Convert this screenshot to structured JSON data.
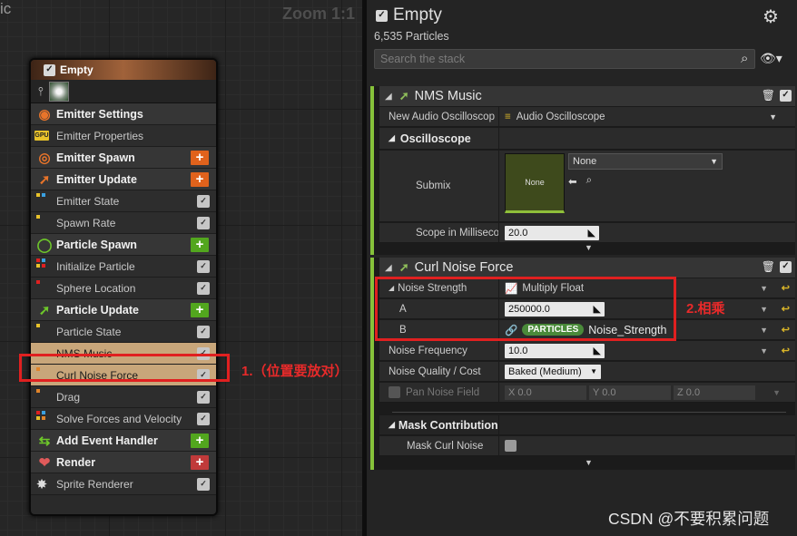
{
  "graph": {
    "corner_text": "ic",
    "zoom": "Zoom 1:1"
  },
  "node": {
    "title": "Empty",
    "rows": [
      {
        "label": "Emitter Settings",
        "kind": "section",
        "icon": "emitter-settings-icon",
        "color": "#e8742a",
        "end": "none"
      },
      {
        "label": "Emitter Properties",
        "kind": "item",
        "icon": "gpu-icon",
        "icon_text": "GPU",
        "end": "none"
      },
      {
        "label": "Emitter Spawn",
        "kind": "section",
        "icon": "emitter-spawn-icon",
        "color": "#e8742a",
        "end": "plus",
        "plus_color": "#e0621c"
      },
      {
        "label": "Emitter Update",
        "kind": "section",
        "icon": "emitter-update-icon",
        "color": "#e8742a",
        "end": "plus",
        "plus_color": "#e0621c"
      },
      {
        "label": "Emitter State",
        "kind": "item",
        "dots": [
          "#e8c22a",
          "#3aa0e0"
        ],
        "end": "check"
      },
      {
        "label": "Spawn Rate",
        "kind": "item",
        "dots": [
          "#e8c22a"
        ],
        "end": "check"
      },
      {
        "label": "Particle Spawn",
        "kind": "section",
        "icon": "particle-spawn-icon",
        "color": "#6ec82a",
        "end": "plus",
        "plus_color": "#52a61e"
      },
      {
        "label": "Initialize Particle",
        "kind": "item",
        "dots": [
          "#e02020",
          "#3aa0e0",
          "#e8c22a",
          "#e02020"
        ],
        "end": "check"
      },
      {
        "label": "Sphere Location",
        "kind": "item",
        "dots": [
          "#e02020"
        ],
        "end": "check"
      },
      {
        "label": "Particle Update",
        "kind": "section",
        "icon": "particle-update-icon",
        "color": "#6ec82a",
        "end": "plus",
        "plus_color": "#52a61e"
      },
      {
        "label": "Particle State",
        "kind": "item",
        "dots": [
          "#e8c22a"
        ],
        "end": "check"
      },
      {
        "label": "NMS Music",
        "kind": "item",
        "highlight": true,
        "dots": [],
        "end": "check"
      },
      {
        "label": "Curl Noise Force",
        "kind": "item",
        "highlight": true,
        "dots": [
          "#e0842a"
        ],
        "end": "check"
      },
      {
        "label": "Drag",
        "kind": "item",
        "dots": [
          "#e0842a"
        ],
        "end": "check"
      },
      {
        "label": "Solve Forces and Velocity",
        "kind": "item",
        "dots": [
          "#e02020",
          "#3aa0e0",
          "#e8c22a",
          "#e0842a"
        ],
        "end": "check"
      },
      {
        "label": "Add Event Handler",
        "kind": "section",
        "icon": "add-event-icon",
        "color": "#6ec82a",
        "end": "plus",
        "plus_color": "#52a61e"
      },
      {
        "label": "Render",
        "kind": "section",
        "icon": "render-icon",
        "color": "#e05a5a",
        "end": "plus",
        "plus_color": "#c03a3a"
      },
      {
        "label": "Sprite Renderer",
        "kind": "item",
        "icon": "sprite-icon",
        "end": "check"
      }
    ]
  },
  "panel": {
    "title": "Empty",
    "particle_count": "6,535 Particles",
    "search_placeholder": "Search the stack",
    "module1": {
      "title": "NMS Music",
      "audio_param_label": "New Audio Oscilloscop",
      "audio_param_value": "Audio Oscilloscope",
      "group_label": "Oscilloscope",
      "submix_label": "Submix",
      "submix_thumb": "None",
      "submix_select": "None",
      "scope_label": "Scope in Milliseco",
      "scope_value": "20.0"
    },
    "module2": {
      "title": "Curl Noise Force",
      "noise_strength_label": "Noise Strength",
      "noise_strength_value": "Multiply Float",
      "a_label": "A",
      "a_value": "250000.0",
      "b_label": "B",
      "b_badge": "PARTICLES",
      "b_value": "Noise_Strength",
      "freq_label": "Noise Frequency",
      "freq_value": "10.0",
      "quality_label": "Noise Quality / Cost",
      "quality_value": "Baked (Medium)",
      "pan_label": "Pan Noise Field",
      "pan_x": "X 0.0",
      "pan_y": "Y 0.0",
      "pan_z": "Z 0.0",
      "mask_group": "Mask Contribution",
      "mask_label": "Mask Curl Noise"
    }
  },
  "annotations": {
    "note1": "1.（位置要放对）",
    "note2": "2.相乘"
  },
  "watermark": "CSDN @不要积累问题",
  "colors": {
    "accent_green": "#86c23a",
    "highlight_row": "#c8a67a",
    "annotation_red": "#e02020"
  }
}
